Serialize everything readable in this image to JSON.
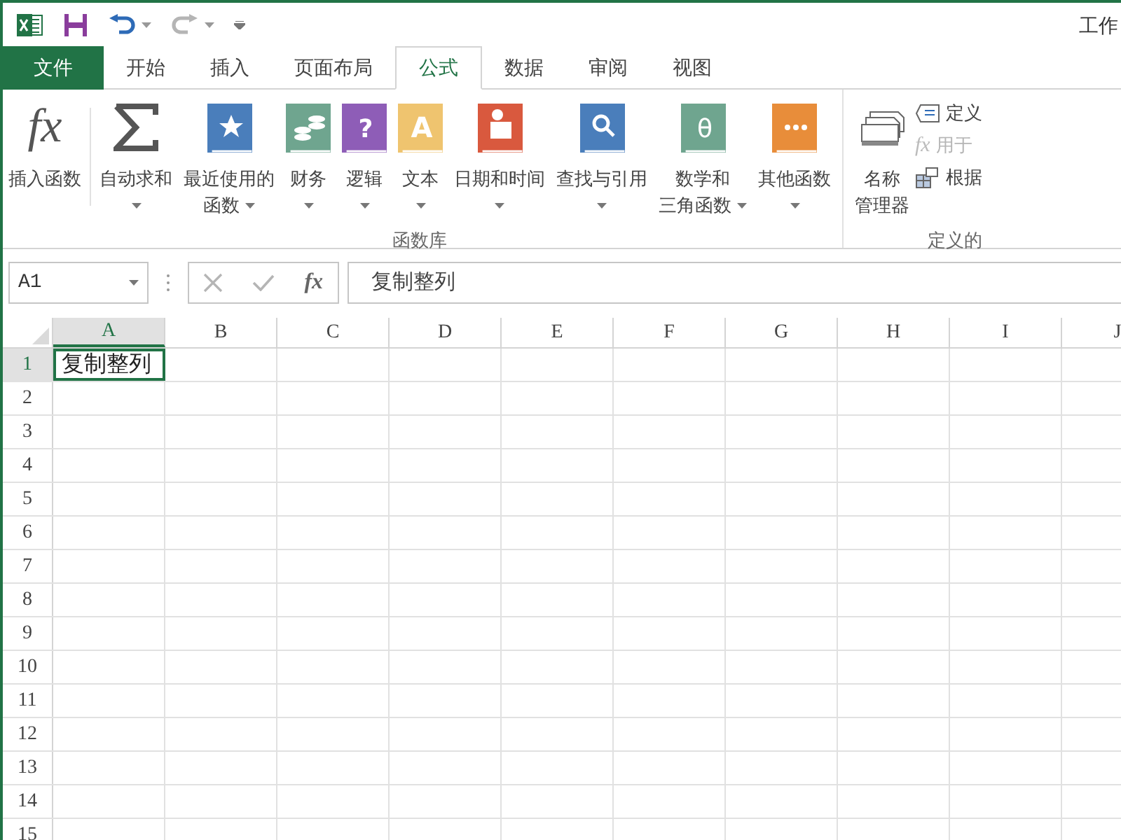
{
  "window": {
    "title": "工作"
  },
  "quick_access": [
    {
      "kind": "app"
    },
    {
      "kind": "save"
    },
    {
      "kind": "undo",
      "disabled": false,
      "dropdown": true
    },
    {
      "kind": "redo",
      "disabled": true,
      "dropdown": true
    },
    {
      "kind": "customize"
    }
  ],
  "tabs": [
    {
      "label": "文件",
      "kind": "file",
      "selected": false
    },
    {
      "label": "开始",
      "kind": "tab",
      "selected": false
    },
    {
      "label": "插入",
      "kind": "tab",
      "selected": false
    },
    {
      "label": "页面布局",
      "kind": "tab",
      "selected": false
    },
    {
      "label": "公式",
      "kind": "tab",
      "selected": true
    },
    {
      "label": "数据",
      "kind": "tab",
      "selected": false
    },
    {
      "label": "审阅",
      "kind": "tab",
      "selected": false
    },
    {
      "label": "视图",
      "kind": "tab",
      "selected": false
    }
  ],
  "ribbon": {
    "groups": [
      {
        "label": "函数库",
        "buttons": [
          {
            "kind": "fx",
            "glyph": "fx",
            "lines": [
              "插入函数"
            ],
            "dropdown": false
          },
          {
            "kind": "sigma",
            "lines": [
              "自动求和"
            ],
            "dropdown": true
          },
          {
            "kind": "star",
            "color": "#4a7ebb",
            "lines": [
              "最近使用的",
              "函数"
            ],
            "dropdown": true
          },
          {
            "kind": "coins",
            "color": "#6fa58f",
            "lines": [
              "财务"
            ],
            "dropdown": true
          },
          {
            "kind": "question",
            "glyph": "?",
            "color": "#8e5db7",
            "lines": [
              "逻辑"
            ],
            "dropdown": true
          },
          {
            "kind": "letter",
            "glyph": "A",
            "color": "#efc46f",
            "lines": [
              "文本"
            ],
            "dropdown": true
          },
          {
            "kind": "calendar",
            "color": "#d9593e",
            "lines": [
              "日期和时间"
            ],
            "dropdown": true
          },
          {
            "kind": "magnifier",
            "color": "#4a7ebb",
            "lines": [
              "查找与引用"
            ],
            "dropdown": true
          },
          {
            "kind": "theta",
            "glyph": "θ",
            "color": "#6fa58f",
            "lines": [
              "数学和",
              "三角函数"
            ],
            "dropdown": true
          },
          {
            "kind": "dots",
            "color": "#e88d3a",
            "lines": [
              "其他函数"
            ],
            "dropdown": true
          }
        ]
      },
      {
        "label": "定义的",
        "buttons": [
          {
            "kind": "name_manager",
            "lines": [
              "名称",
              "管理器"
            ],
            "dropdown": false
          }
        ],
        "small_buttons": [
          {
            "kind": "tag",
            "label": "定义",
            "disabled": false
          },
          {
            "kind": "fx_tag",
            "glyph": "fx",
            "label": "用于",
            "disabled": true
          },
          {
            "kind": "grid_tag",
            "label": "根据",
            "disabled": false
          }
        ]
      }
    ]
  },
  "formula_bar": {
    "name_box": "A1",
    "function_glyph": "fx",
    "content": "复制整列"
  },
  "sheet": {
    "columns": [
      {
        "label": "A",
        "selected": true
      },
      {
        "label": "B",
        "selected": false
      },
      {
        "label": "C",
        "selected": false
      },
      {
        "label": "D",
        "selected": false
      },
      {
        "label": "E",
        "selected": false
      },
      {
        "label": "F",
        "selected": false
      },
      {
        "label": "G",
        "selected": false
      },
      {
        "label": "H",
        "selected": false
      },
      {
        "label": "I",
        "selected": false
      },
      {
        "label": "J",
        "selected": false
      }
    ],
    "rows": [
      {
        "label": "1",
        "selected": true,
        "cells": [
          {
            "text": "复制整列",
            "selected": true
          }
        ]
      },
      {
        "label": "2",
        "selected": false
      },
      {
        "label": "3",
        "selected": false
      },
      {
        "label": "4",
        "selected": false
      },
      {
        "label": "5",
        "selected": false
      },
      {
        "label": "6",
        "selected": false
      },
      {
        "label": "7",
        "selected": false
      },
      {
        "label": "8",
        "selected": false
      },
      {
        "label": "9",
        "selected": false
      },
      {
        "label": "10",
        "selected": false
      },
      {
        "label": "11",
        "selected": false
      },
      {
        "label": "12",
        "selected": false
      },
      {
        "label": "13",
        "selected": false
      },
      {
        "label": "14",
        "selected": false
      },
      {
        "label": "15",
        "selected": false
      }
    ]
  }
}
